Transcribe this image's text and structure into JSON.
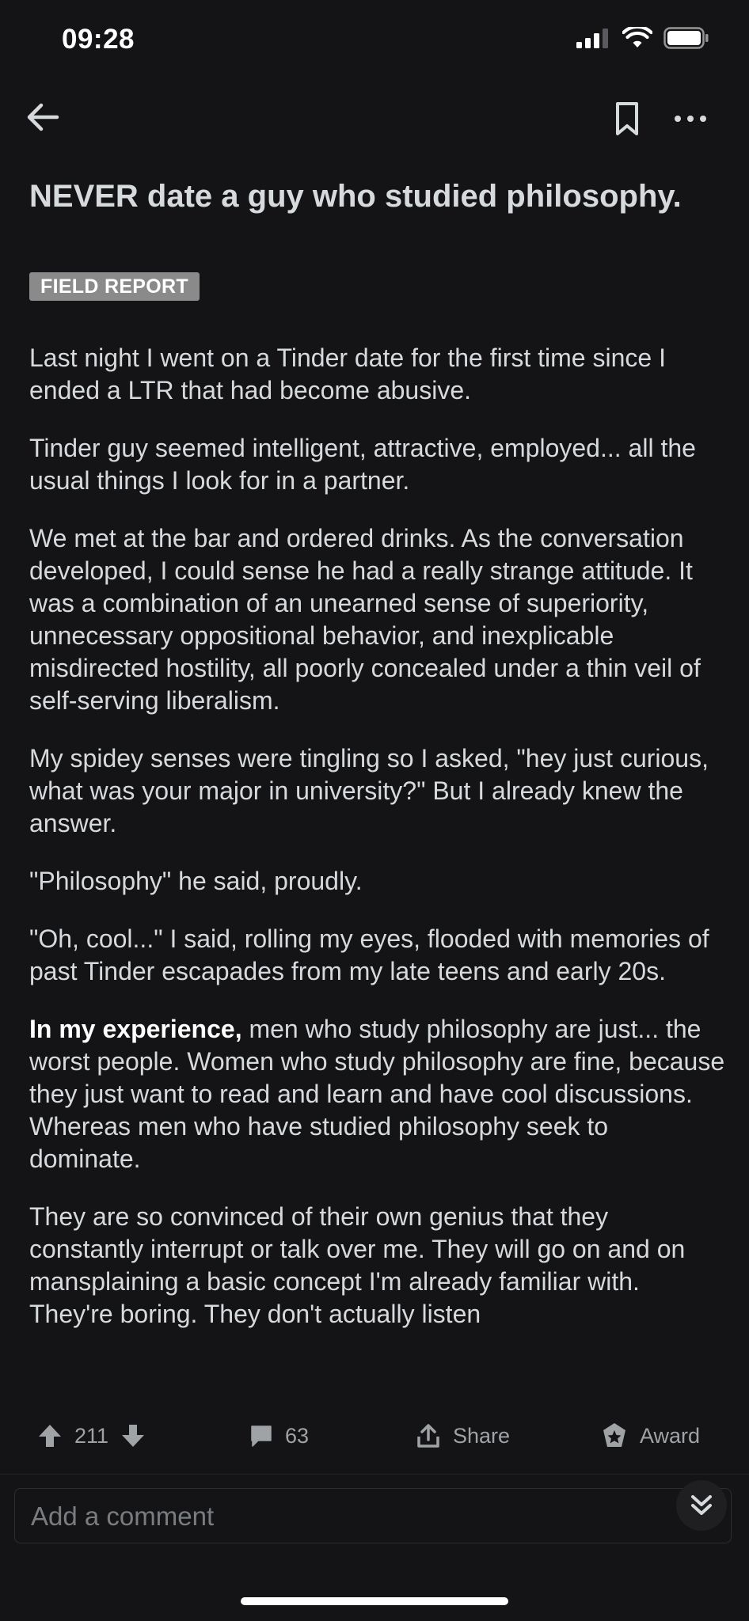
{
  "status_bar": {
    "time": "09:28"
  },
  "nav": {
    "back_icon": "arrow-left-icon",
    "bookmark_icon": "bookmark-icon",
    "more_icon": "more-horizontal-icon"
  },
  "post": {
    "title": "NEVER date a guy who studied philosophy.",
    "flair": "FIELD REPORT",
    "paragraphs": {
      "p1": "Last night I went on a Tinder date for the first time since I ended a LTR that had become abusive.",
      "p2": "Tinder guy seemed intelligent, attractive, employed... all the usual things I look for in a partner.",
      "p3": "We met at the bar and ordered drinks. As the conversation developed, I could sense he had a really strange attitude. It was a combination of an unearned sense of superiority, unnecessary oppositional behavior, and inexplicable misdirected hostility, all poorly concealed under a thin veil of self-serving liberalism.",
      "p4": "My spidey senses were tingling so I asked, \"hey just curious, what was your major in university?\" But I already knew the answer.",
      "p5": "\"Philosophy\" he said, proudly.",
      "p6": "\"Oh, cool...\" I said, rolling my eyes, flooded with memories of past Tinder escapades from my late teens and early 20s.",
      "p7_bold": "In my experience,",
      "p7_rest": " men who study philosophy are just... the worst people. Women who study philosophy are fine, because they just want to read and learn and have cool discussions. Whereas men who have studied philosophy seek to dominate.",
      "p8": "They are so convinced of their own genius that they constantly interrupt or talk over me. They will go on and on mansplaining a basic concept I'm already familiar with. They're boring. They don't actually listen"
    }
  },
  "actions": {
    "upvotes": "211",
    "comments": "63",
    "share_label": "Share",
    "award_label": "Award"
  },
  "comment": {
    "placeholder": "Add a comment"
  },
  "colors": {
    "background": "#141416",
    "text": "#d7dadc",
    "muted": "#a0a3a6",
    "flair_bg": "#8a8a8a"
  }
}
